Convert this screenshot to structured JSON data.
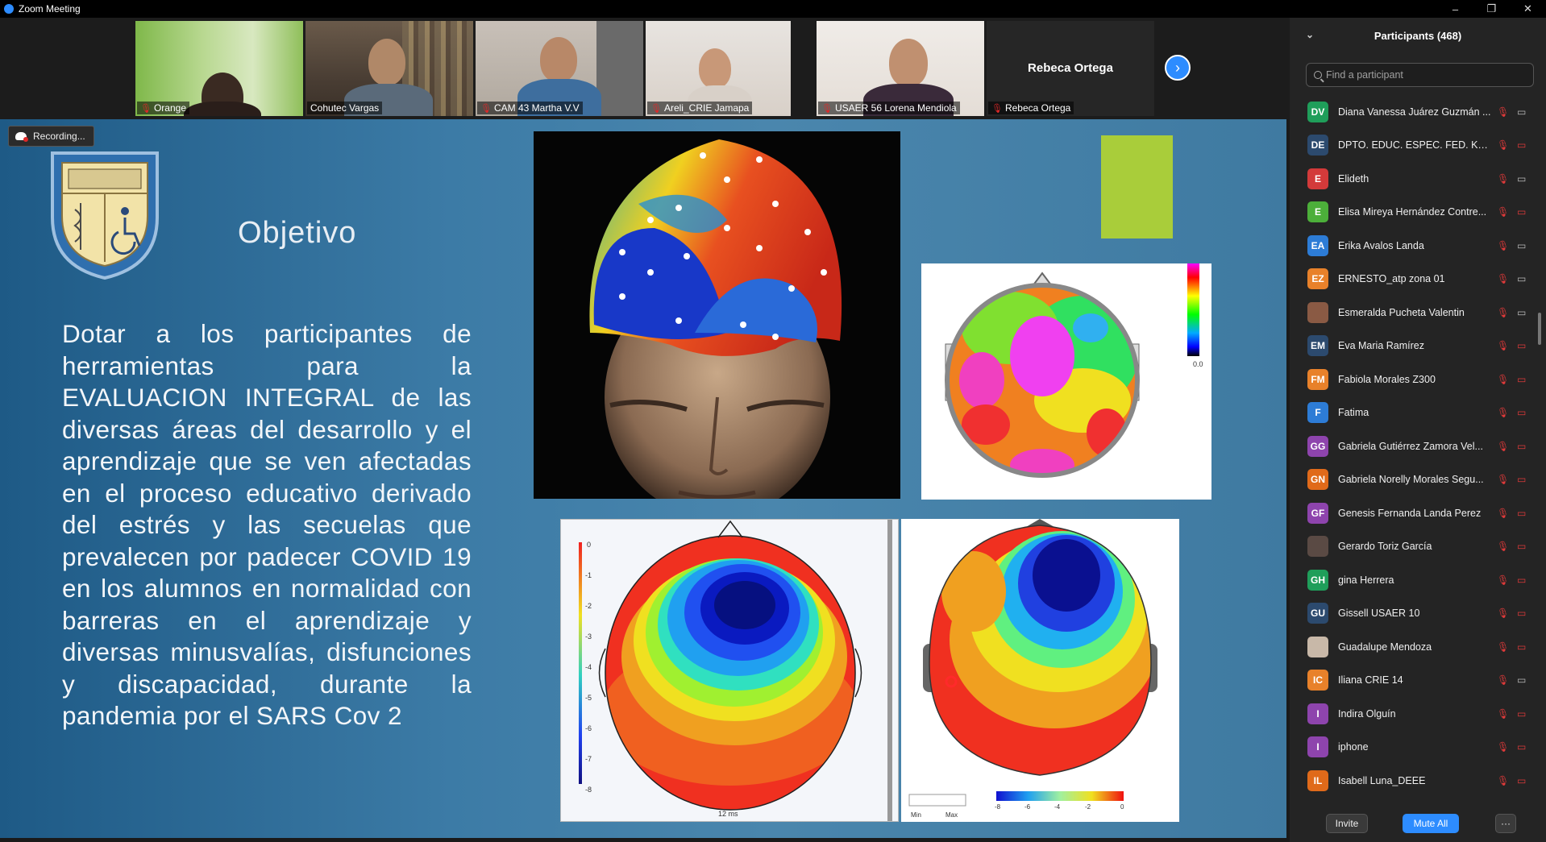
{
  "window": {
    "title": "Zoom Meeting",
    "controls": [
      "–",
      "❐",
      "✕"
    ]
  },
  "video_strip": {
    "tiles": [
      {
        "name": "Orange",
        "muted": true
      },
      {
        "name": "Cohutec Vargas",
        "muted": false,
        "active": true
      },
      {
        "name": "CAM 43 Martha V.V",
        "muted": true
      },
      {
        "name": "Areli_CRIE Jamapa",
        "muted": true
      },
      {
        "name": "USAER 56 Lorena Mendiola",
        "muted": true
      },
      {
        "name": "Rebeca Ortega",
        "muted": true,
        "display_name": "Rebeca Ortega"
      }
    ],
    "next_glyph": "›"
  },
  "share": {
    "recording_label": "Recording...",
    "slide": {
      "title": "Objetivo",
      "body": "Dotar a los participantes de herramientas para la EVALUACION INTEGRAL de las diversas áreas del desarrollo y el aprendizaje que se ven afectadas en el proceso educativo derivado del estrés y las secuelas que prevalecen por padecer COVID 19 en los alumnos en normalidad con barreras en el aprendizaje y diversas minusvalías, disfunciones y discapacidad, durante la pandemia por el SARS Cov 2",
      "accent_color": "#a9cd3a",
      "images": {
        "topomap_small_scale_label": "0.0",
        "topomap_bottom_left_time": "12 ms",
        "topomap_bottom_left_ticks": [
          "0",
          "-1",
          "-2",
          "-3",
          "-4",
          "-5",
          "-6",
          "-7",
          "-8"
        ],
        "topomap_bottom_right_minmax": [
          "Min",
          "Max"
        ],
        "topomap_bottom_right_ticks": [
          "-8",
          "-6",
          "-4",
          "-2",
          "0"
        ]
      }
    }
  },
  "participants_panel": {
    "title": "Participants (468)",
    "search_placeholder": "Find a participant",
    "participants": [
      {
        "initials": "DV",
        "name": "Diana Vanessa Juárez Guzmán ...",
        "color": "#1f9e5a",
        "cam": "on"
      },
      {
        "initials": "DE",
        "name": "DPTO. EDUC. ESPEC. FED. KERE...",
        "color": "#2c4a6e",
        "cam": "off"
      },
      {
        "initials": "E",
        "name": "Elideth",
        "color": "#d33a3a",
        "cam": "on"
      },
      {
        "initials": "E",
        "name": "Elisa Mireya Hernández Contre...",
        "color": "#4caf3a",
        "cam": "off"
      },
      {
        "initials": "EA",
        "name": "Erika Avalos Landa",
        "color": "#2d7cd6",
        "cam": "on"
      },
      {
        "initials": "EZ",
        "name": "ERNESTO_atp zona 01",
        "color": "#e8812a",
        "cam": "on"
      },
      {
        "initials": "",
        "name": "Esmeralda Pucheta Valentin",
        "color": "#8a5a44",
        "cam": "on",
        "photo": true
      },
      {
        "initials": "EM",
        "name": "Eva Maria Ramírez",
        "color": "#2c4a6e",
        "cam": "off"
      },
      {
        "initials": "FM",
        "name": "Fabiola Morales Z300",
        "color": "#e8812a",
        "cam": "off"
      },
      {
        "initials": "F",
        "name": "Fatima",
        "color": "#2d7cd6",
        "cam": "off"
      },
      {
        "initials": "GG",
        "name": "Gabriela Gutiérrez Zamora Vel...",
        "color": "#8e44ad",
        "cam": "off"
      },
      {
        "initials": "GN",
        "name": "Gabriela Norelly Morales Segu...",
        "color": "#e06a1a",
        "cam": "off"
      },
      {
        "initials": "GF",
        "name": "Genesis Fernanda Landa Perez",
        "color": "#8e44ad",
        "cam": "off"
      },
      {
        "initials": "",
        "name": "Gerardo Toriz García",
        "color": "#5a4a44",
        "cam": "off",
        "photo": true
      },
      {
        "initials": "GH",
        "name": "gina Herrera",
        "color": "#1f9e5a",
        "cam": "off"
      },
      {
        "initials": "GU",
        "name": "Gissell USAER 10",
        "color": "#2c4a6e",
        "cam": "off"
      },
      {
        "initials": "",
        "name": "Guadalupe Mendoza",
        "color": "#c8b8a8",
        "cam": "off",
        "photo": true
      },
      {
        "initials": "IC",
        "name": "Iliana CRIE 14",
        "color": "#e8812a",
        "cam": "on"
      },
      {
        "initials": "I",
        "name": "Indira Olguín",
        "color": "#8e44ad",
        "cam": "off"
      },
      {
        "initials": "I",
        "name": "iphone",
        "color": "#8e44ad",
        "cam": "off"
      },
      {
        "initials": "IL",
        "name": "Isabell Luna_DEEE",
        "color": "#e06a1a",
        "cam": "off"
      }
    ],
    "footer": {
      "invite": "Invite",
      "mute_all": "Mute All",
      "more": "···"
    }
  }
}
